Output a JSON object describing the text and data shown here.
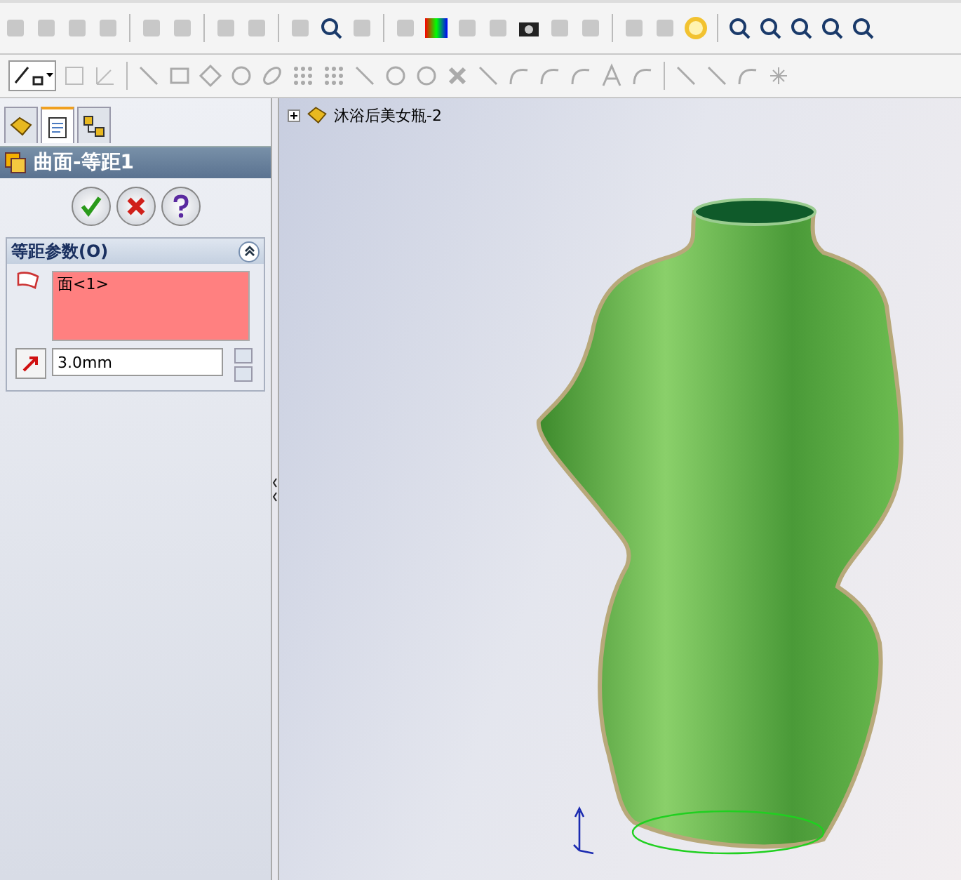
{
  "panel_tabs": [
    {
      "kind": "feature",
      "selected": false
    },
    {
      "kind": "property",
      "selected": true
    },
    {
      "kind": "config",
      "selected": false
    }
  ],
  "property_manager": {
    "title": "曲面-等距1",
    "section": {
      "title": "等距参数(O)",
      "expanded": true,
      "selections": [
        "面<1>"
      ],
      "distance": "3.0mm"
    }
  },
  "tree": {
    "item": "沐浴后美女瓶-2",
    "expanded": false
  }
}
